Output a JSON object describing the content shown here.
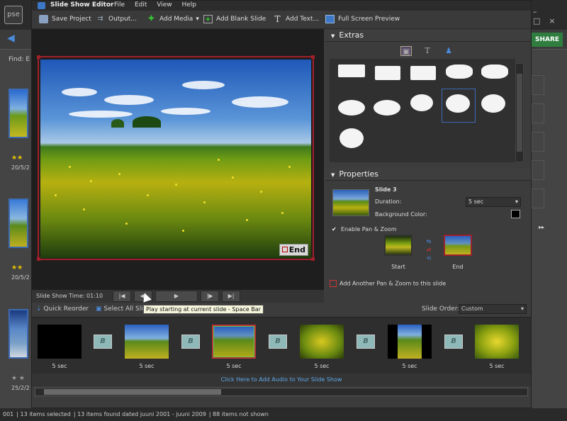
{
  "background_app": {
    "logo": "pse",
    "share_label": "SHARE",
    "find_label": "Find: E",
    "thumbs": [
      {
        "stars": "★★",
        "date": "20/5/2"
      },
      {
        "stars": "★★",
        "date": "20/5/2"
      },
      {
        "stars": "★ ★",
        "date": "25/2/2"
      }
    ],
    "nav_arrows": "▸▸",
    "status": {
      "count_prefix": "001",
      "selected": "13 items selected",
      "found": "13 items found dated juuni 2001 - juuni 2009",
      "not_shown": "88 items not shown"
    }
  },
  "editor": {
    "title": "Slide Show Editor",
    "menu": [
      "File",
      "Edit",
      "View",
      "Help"
    ],
    "toolbar": {
      "save": "Save Project",
      "output": "Output...",
      "add_media": "Add Media",
      "add_blank": "Add Blank Slide",
      "add_text": "Add Text...",
      "full_screen": "Full Screen Preview"
    },
    "preview": {
      "end_badge": "End"
    },
    "playbar": {
      "time_label": "Slide Show Time: 01:10"
    },
    "controls": {
      "quick_reorder": "Quick Reorder",
      "select_all": "Select All Slides",
      "tooltip": "Play starting at current slide - Space Bar",
      "slide_order_label": "Slide Order:",
      "slide_order_value": "Custom"
    },
    "filmstrip": {
      "slides": [
        {
          "duration": "5 sec"
        },
        {
          "duration": "5 sec"
        },
        {
          "duration": "5 sec"
        },
        {
          "duration": "5 sec"
        },
        {
          "duration": "5 sec"
        },
        {
          "duration": "5 sec"
        }
      ],
      "transition_glyph": "B"
    },
    "audio_link": "Click Here to Add Audio to Your Slide Show",
    "extras": {
      "title": "Extras"
    },
    "properties": {
      "title": "Properties",
      "slide_name": "Slide 3",
      "duration_label": "Duration:",
      "duration_value": "5 sec",
      "bg_color_label": "Background Color:",
      "pan_zoom_label": "Enable Pan & Zoom",
      "start_label": "Start",
      "end_label": "End",
      "add_pan_zoom": "Add Another Pan & Zoom to this slide"
    }
  }
}
